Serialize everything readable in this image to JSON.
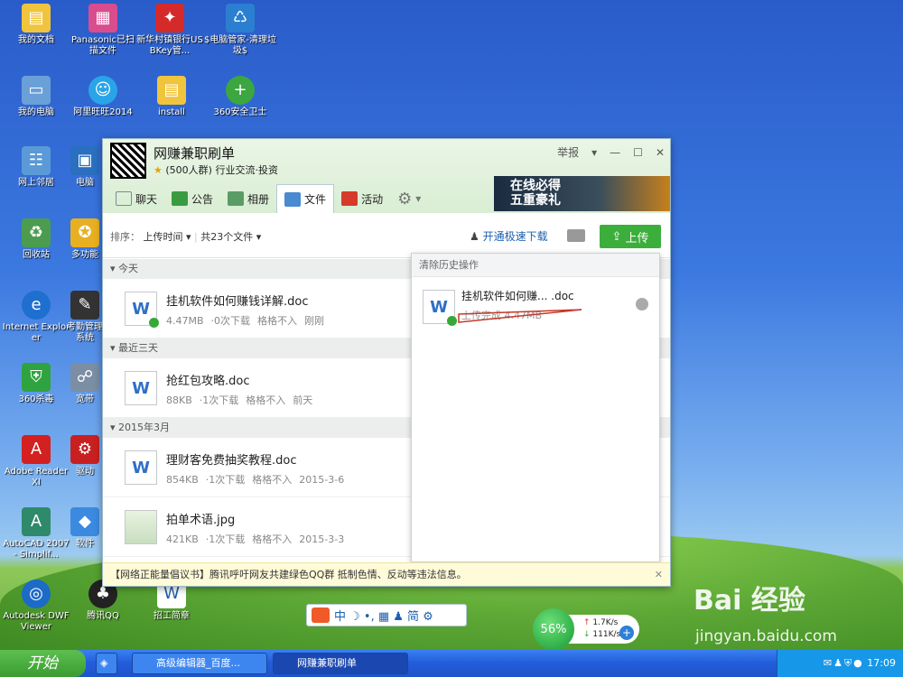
{
  "desktop": {
    "icons": [
      {
        "label": "我的文档"
      },
      {
        "label": "Panasonic已扫描文件"
      },
      {
        "label": "新华村镇银行USBKey管..."
      },
      {
        "label": "$电脑管家-清理垃圾$"
      },
      {
        "label": "我的电脑"
      },
      {
        "label": "阿里旺旺2014"
      },
      {
        "label": "install"
      },
      {
        "label": "360安全卫士"
      },
      {
        "label": "网上邻居"
      },
      {
        "label": "电脑"
      },
      {
        "label": "回收站"
      },
      {
        "label": "多功能"
      },
      {
        "label": "Internet Explorer"
      },
      {
        "label": "考勤管理系统"
      },
      {
        "label": "360杀毒"
      },
      {
        "label": "宽带"
      },
      {
        "label": "Adobe Reader XI"
      },
      {
        "label": "驱动"
      },
      {
        "label": "AutoCAD 2007 - Simplif..."
      },
      {
        "label": "软件"
      },
      {
        "label": "Autodesk DWF Viewer"
      },
      {
        "label": "腾讯QQ"
      },
      {
        "label": "招工简章"
      }
    ]
  },
  "window": {
    "title": "网赚兼职刷单",
    "subtitle_count": "(500人群)",
    "subtitle_tags": "行业交流·投资",
    "report": "举报",
    "tabs": [
      {
        "label": "聊天"
      },
      {
        "label": "公告"
      },
      {
        "label": "相册"
      },
      {
        "label": "文件"
      },
      {
        "label": "活动"
      }
    ],
    "ad_line1": "在线必得",
    "ad_line2": "五重豪礼",
    "toolbar": {
      "sort_label": "排序：",
      "sort_value": "上传时间 ▾",
      "count": "共23个文件 ▾",
      "speed_link": "开通极速下载",
      "upload": "上传"
    },
    "groups": [
      {
        "title": "今天",
        "files": [
          {
            "name": "挂机软件如何赚钱详解.doc",
            "size": "4.47MB",
            "downloads": "0次下载",
            "uploader": "格格不入",
            "time": "刚刚",
            "icon": "W"
          }
        ]
      },
      {
        "title": "最近三天",
        "files": [
          {
            "name": "抢红包攻略.doc",
            "size": "88KB",
            "downloads": "1次下载",
            "uploader": "格格不入",
            "time": "前天",
            "icon": "W"
          }
        ]
      },
      {
        "title": "2015年3月",
        "files": [
          {
            "name": "理财客免费抽奖教程.doc",
            "size": "854KB",
            "downloads": "1次下载",
            "uploader": "格格不入",
            "time": "2015-3-6",
            "icon": "W"
          },
          {
            "name": "拍单术语.jpg",
            "size": "421KB",
            "downloads": "1次下载",
            "uploader": "格格不入",
            "time": "2015-3-3",
            "icon": ""
          }
        ]
      }
    ],
    "notice": "【网络正能量倡议书】腾讯呼吁网友共建绿色QQ群 抵制色情、反动等违法信息。",
    "history_popup": {
      "header": "清除历史操作",
      "file_name": "挂机软件如何赚... .doc",
      "status": "上传完成  4.47MB"
    }
  },
  "ime": {
    "chars": "中 ☽ •, ▦ ♟ 简 ⚙"
  },
  "network": {
    "percent": "56%",
    "up": "1.7K/s",
    "down": "111K/s"
  },
  "watermark": {
    "brand": "Bai 经验",
    "url": "jingyan.baidu.com"
  },
  "taskbar": {
    "start": "开始",
    "buttons": [
      {
        "label": "高级编辑器_百度..."
      },
      {
        "label": "网赚兼职刷单"
      }
    ],
    "clock": "17:09"
  }
}
